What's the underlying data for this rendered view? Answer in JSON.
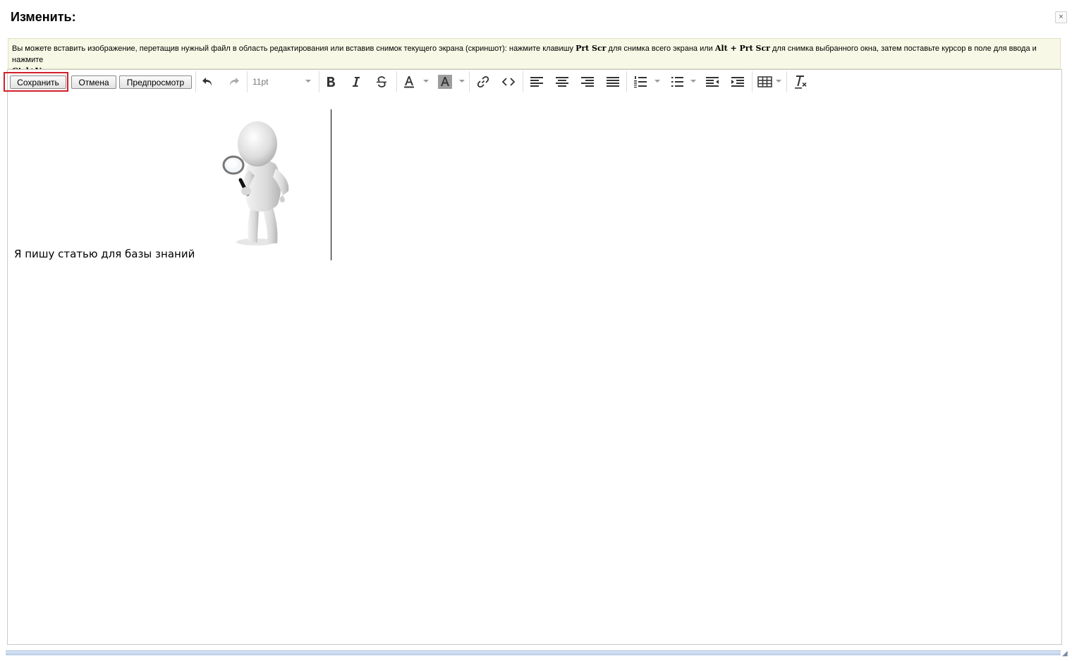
{
  "dialog": {
    "title": "Изменить:",
    "close_label": "×"
  },
  "hint": {
    "part1": "Вы можете вставить изображение, перетащив нужный файл в область редактирования или вставив снимок текущего экрана (скриншот): нажмите клавишу ",
    "key1": "Prt Scr",
    "part2": " для снимка всего экрана или ",
    "key2": "Alt + Prt Scr",
    "part3": " для снимка выбранного окна, затем поставьте курсор в поле для ввода и нажмите ",
    "key3": "Ctrl+V"
  },
  "toolbar": {
    "save_label": "Сохранить",
    "cancel_label": "Отмена",
    "preview_label": "Предпросмотр",
    "font_size": "11pt",
    "highlight_color": "#d2202a"
  },
  "editor": {
    "text": "Я пишу статью для базы знаний",
    "image_icon": "3d-man-magnifier-image"
  },
  "icons": [
    "undo-icon",
    "redo-icon",
    "bold-icon",
    "italic-icon",
    "strikethrough-icon",
    "text-color-icon",
    "background-color-icon",
    "link-icon",
    "code-icon",
    "align-left-icon",
    "align-center-icon",
    "align-right-icon",
    "align-justify-icon",
    "numbered-list-icon",
    "bullet-list-icon",
    "outdent-icon",
    "indent-icon",
    "table-icon",
    "clear-formatting-icon"
  ]
}
